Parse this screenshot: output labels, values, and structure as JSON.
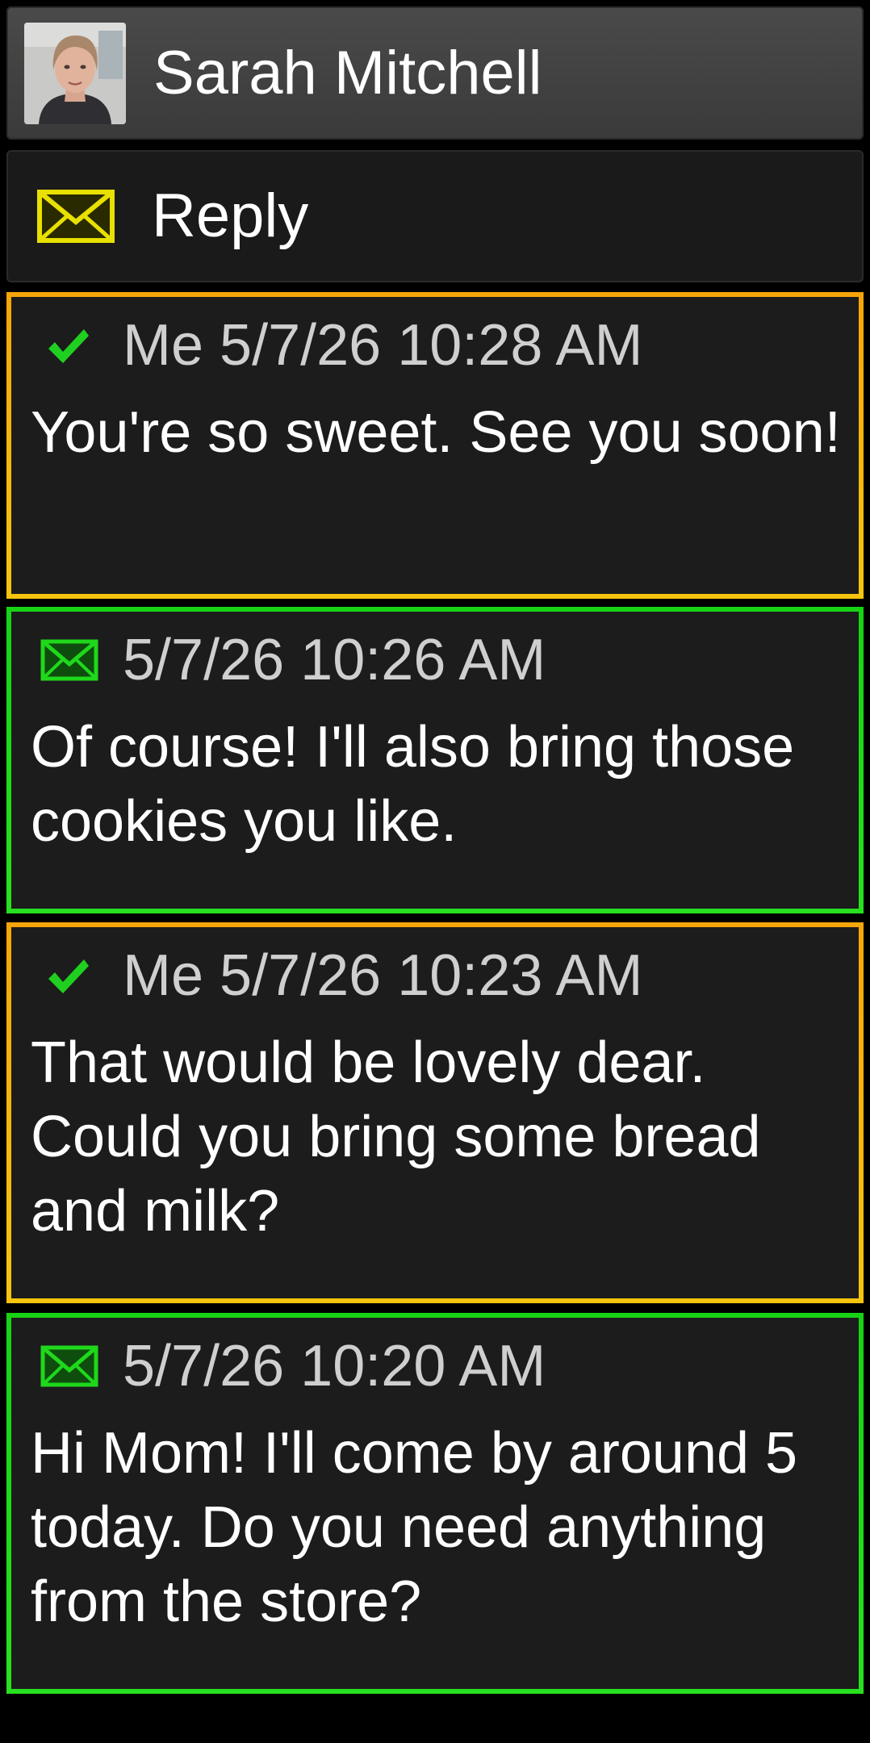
{
  "contact": {
    "name": "Sarah Mitchell",
    "avatar_icon": "contact-photo"
  },
  "reply": {
    "label": "Reply",
    "icon": "envelope-icon",
    "icon_color": "#e8e000"
  },
  "colors": {
    "sent_border": "#f4b40c",
    "received_border": "#1fd81b",
    "check_green": "#20d020",
    "meta_text": "#cfcfcf"
  },
  "messages": [
    {
      "direction": "sent",
      "status_icon": "check-icon",
      "meta": "Me 5/7/26 10:28 AM",
      "body": "You're so sweet. See you soon!"
    },
    {
      "direction": "received",
      "status_icon": "envelope-icon",
      "meta": "5/7/26 10:26 AM",
      "body": "Of course! I'll also bring those cookies you like."
    },
    {
      "direction": "sent",
      "status_icon": "check-icon",
      "meta": "Me 5/7/26 10:23 AM",
      "body": "That would be lovely dear. Could you bring some bread and milk?"
    },
    {
      "direction": "received",
      "status_icon": "envelope-icon",
      "meta": "5/7/26 10:20 AM",
      "body": "Hi Mom! I'll come by around 5 today. Do you need anything from the store?"
    }
  ]
}
